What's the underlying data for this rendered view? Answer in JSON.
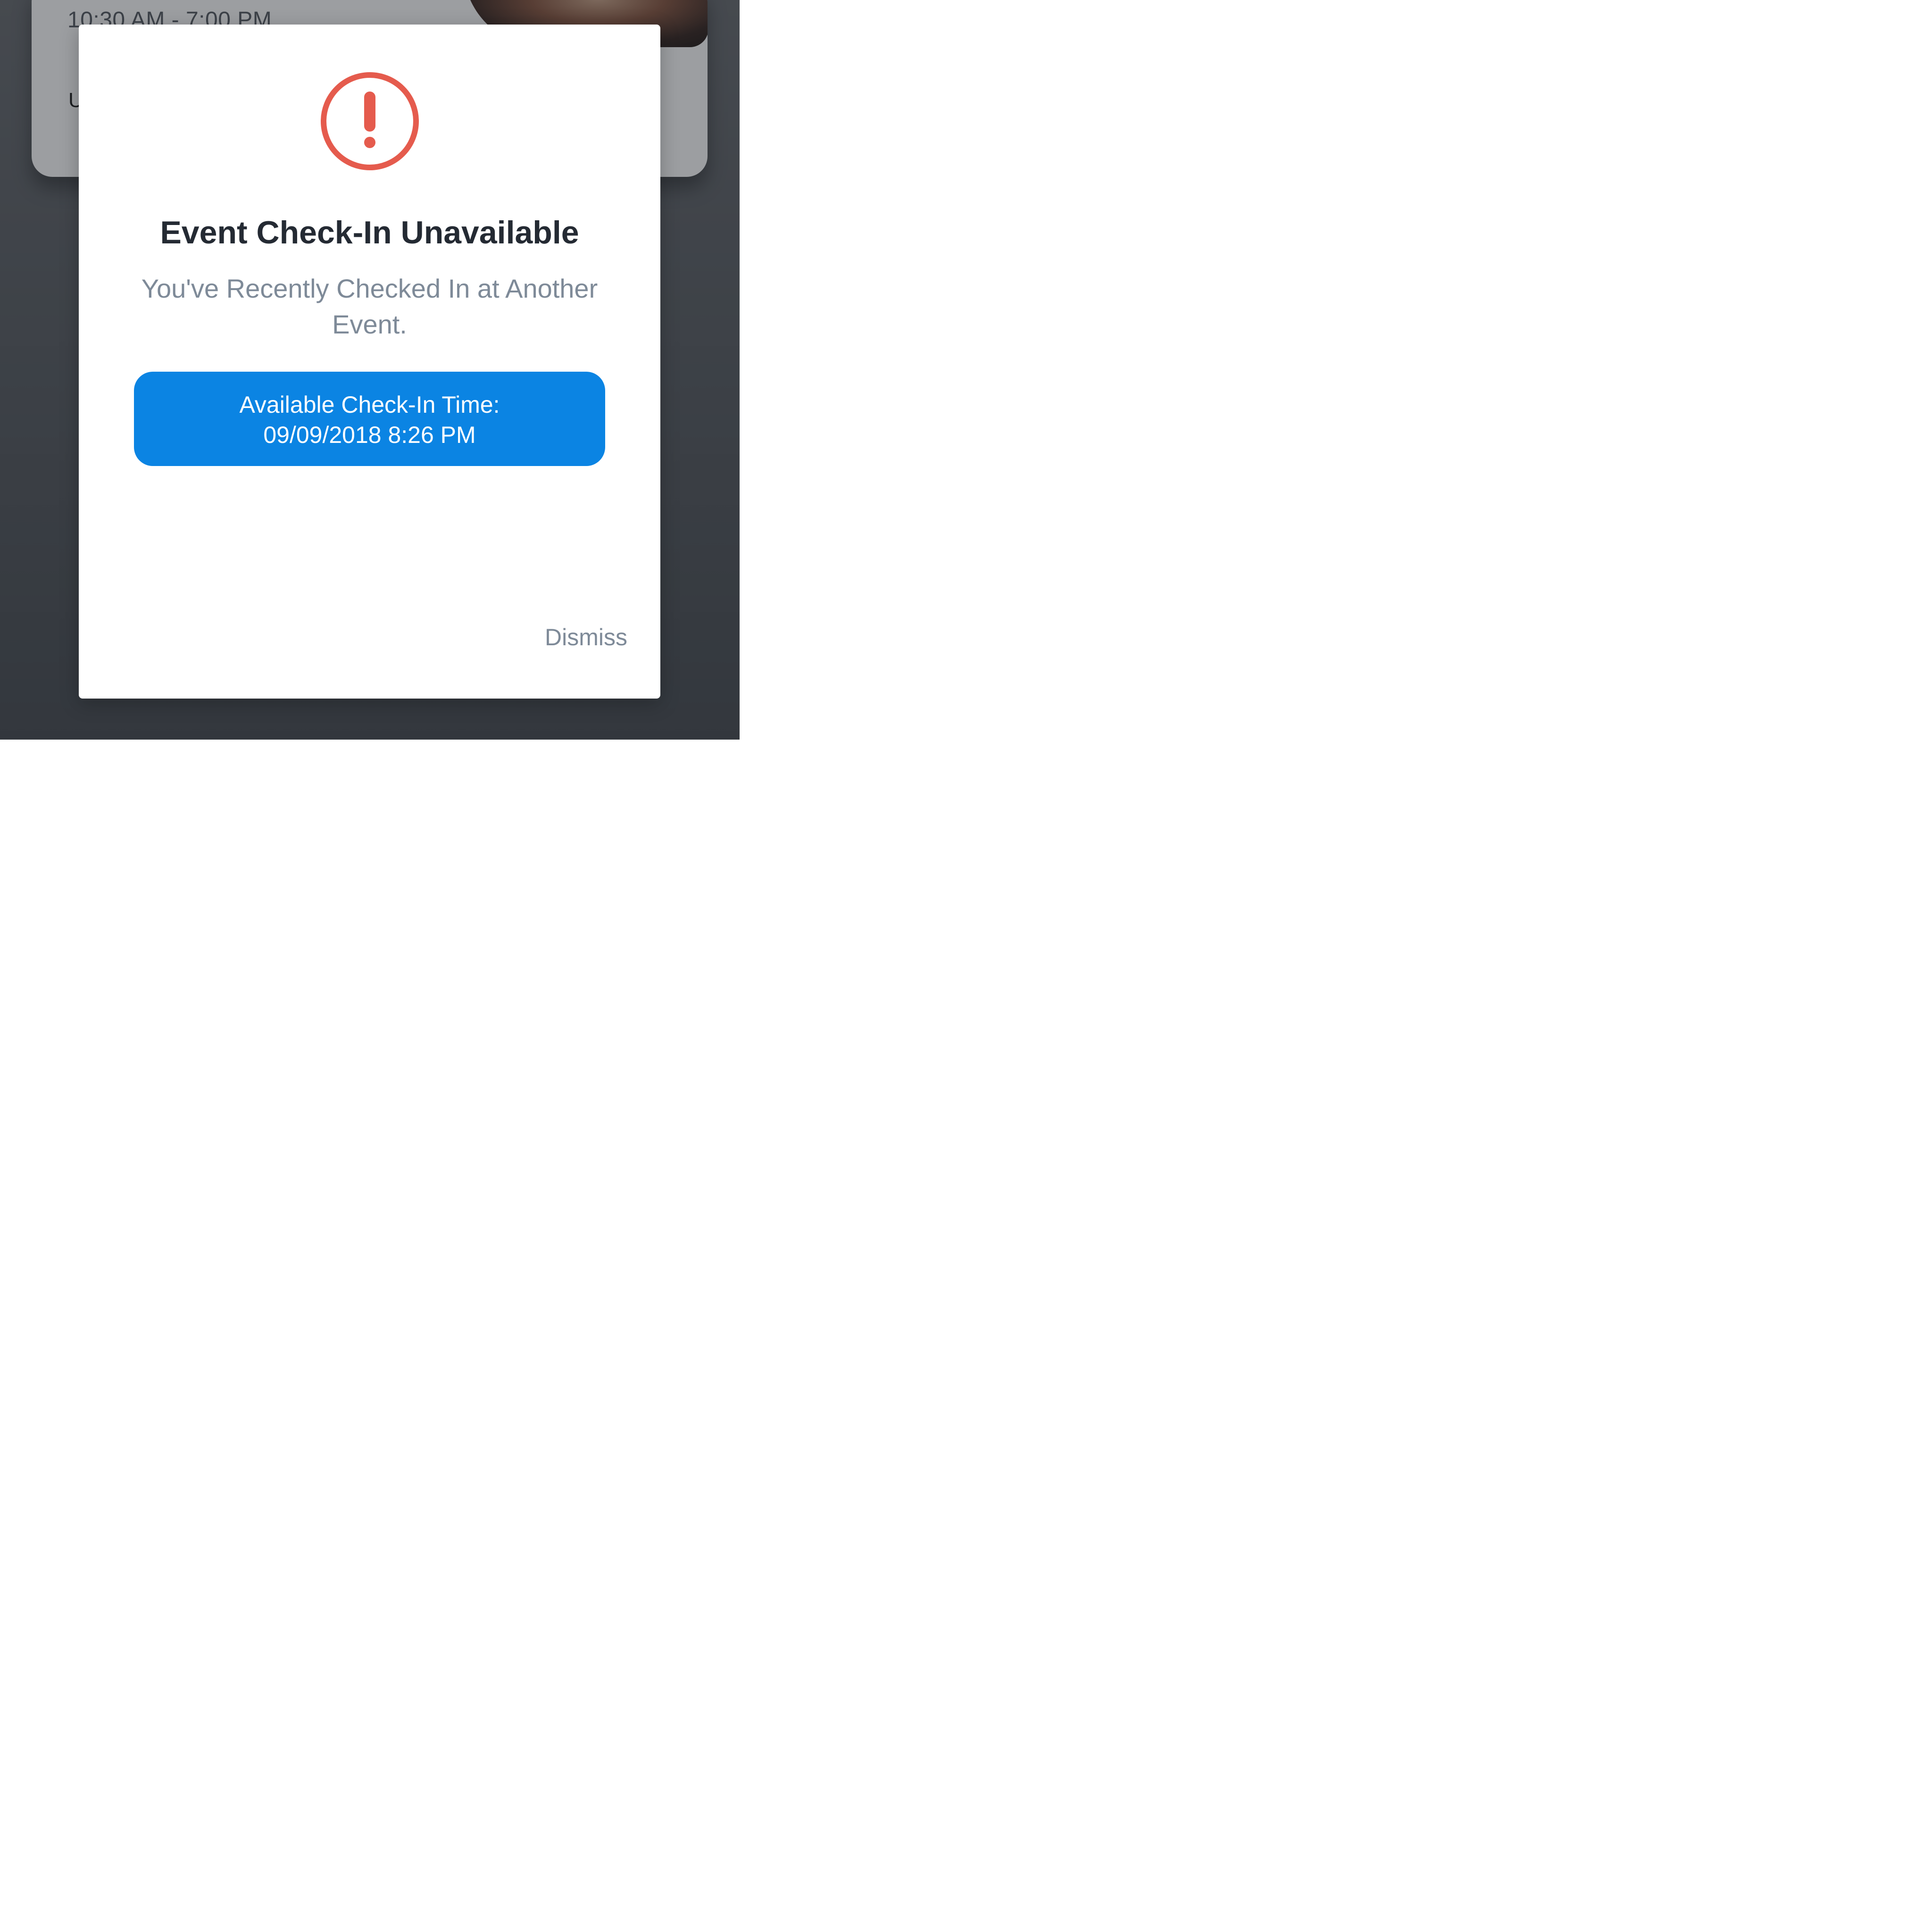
{
  "background_card": {
    "time_text": "10:30 AM - 7:00 PM",
    "partial_text": "U"
  },
  "modal": {
    "icon": "exclamation-circle-icon",
    "icon_color": "#e55b4d",
    "title": "Event Check-In Unavailable",
    "subtitle": "You've Recently Checked In at Another Event.",
    "time_button": {
      "label": "Available Check-In Time:",
      "value": "09/09/2018 8:26 PM",
      "color": "#0b84e3"
    },
    "dismiss_label": "Dismiss"
  }
}
